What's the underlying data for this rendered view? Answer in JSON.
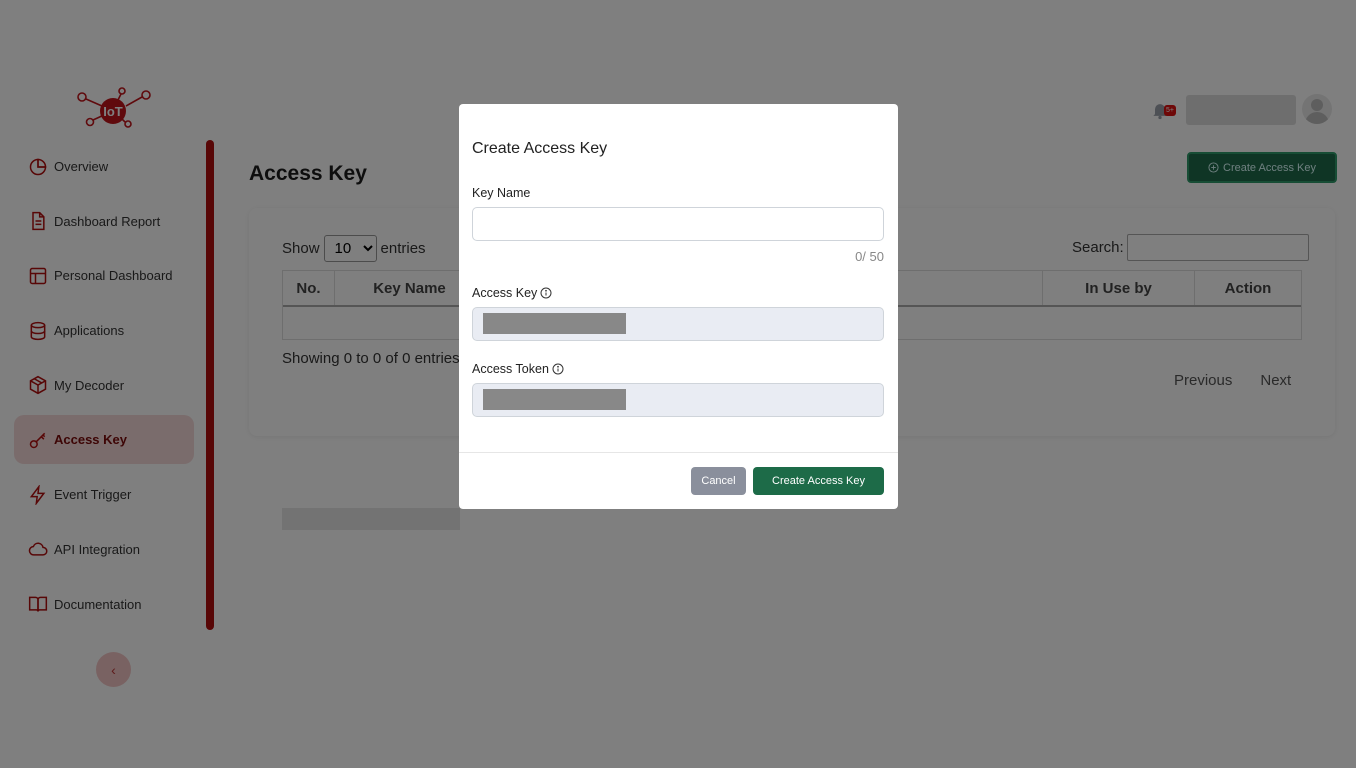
{
  "brand": {
    "logo_text": "IoT"
  },
  "sidebar": {
    "items": [
      {
        "label": "Overview",
        "icon": "pie-chart-icon",
        "active": false
      },
      {
        "label": "Dashboard Report",
        "icon": "document-icon",
        "active": false
      },
      {
        "label": "Personal Dashboard",
        "icon": "layout-icon",
        "active": false
      },
      {
        "label": "Applications",
        "icon": "database-icon",
        "active": false
      },
      {
        "label": "My Decoder",
        "icon": "package-icon",
        "active": false
      },
      {
        "label": "Access Key",
        "icon": "key-icon",
        "active": true
      },
      {
        "label": "Event Trigger",
        "icon": "lightning-icon",
        "active": false
      },
      {
        "label": "API Integration",
        "icon": "cloud-icon",
        "active": false
      },
      {
        "label": "Documentation",
        "icon": "book-icon",
        "active": false
      }
    ],
    "collapse_glyph": "‹"
  },
  "header": {
    "notification_badge": "5+"
  },
  "main": {
    "page_title": "Access Key",
    "create_button_label": "Create Access Key",
    "show_label": "Show",
    "entries_label": "entries",
    "page_size": "10",
    "search_label": "Search:",
    "table": {
      "columns": [
        "No.",
        "Key Name",
        "",
        "In Use by",
        "Action"
      ]
    },
    "showing_text": "Showing 0 to 0 of 0 entries",
    "pager": {
      "previous": "Previous",
      "next": "Next"
    }
  },
  "modal": {
    "title": "Create Access Key",
    "key_name_label": "Key Name",
    "key_name_value": "",
    "counter": "0/ 50",
    "access_key_label": "Access Key",
    "access_token_label": "Access Token",
    "cancel_label": "Cancel",
    "create_label": "Create Access Key"
  },
  "colors": {
    "brand_red": "#b00f0f",
    "primary_green": "#1d6b48",
    "cancel_gray": "#8a8f9c"
  }
}
